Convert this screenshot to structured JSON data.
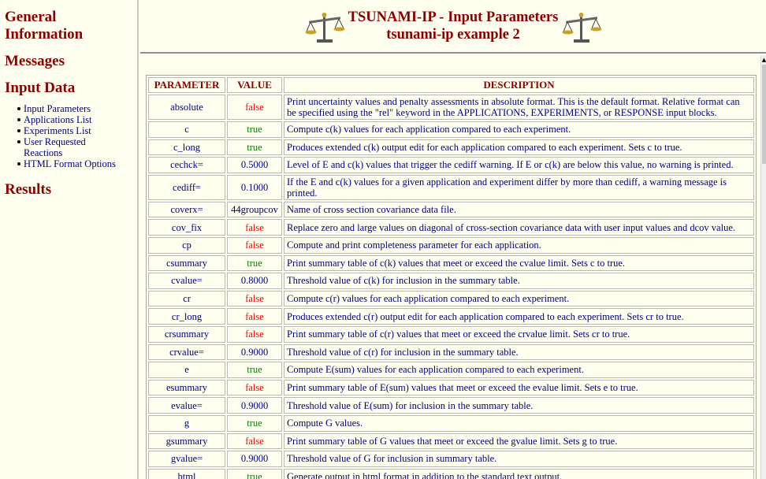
{
  "nav": {
    "general": "General\nInformation",
    "messages": "Messages",
    "input_data": "Input Data",
    "sub_items": [
      "Input Parameters",
      "Applications List",
      "Experiments List",
      "User Requested\nReactions",
      "HTML Format Options"
    ],
    "results": "Results"
  },
  "header": {
    "title": "TSUNAMI-IP - Input Parameters",
    "subtitle": "tsunami-ip example 2"
  },
  "table": {
    "headers": [
      "PARAMETER",
      "VALUE",
      "DESCRIPTION"
    ],
    "rows": [
      {
        "param": "absolute",
        "value": "false",
        "desc": "Print uncertainty values and penalty assessments in absolute format. This is the default format. Relative format can be specified using the \"rel\" keyword in the APPLICATIONS, EXPERIMENTS, or RESPONSE input blocks."
      },
      {
        "param": "c",
        "value": "true",
        "desc": "Compute c(k) values for each application compared to each experiment."
      },
      {
        "param": "c_long",
        "value": "true",
        "desc": "Produces extended c(k) output edit for each application compared to each experiment. Sets c to true."
      },
      {
        "param": "cechck=",
        "value": "0.5000",
        "desc": "Level of E and c(k) values that trigger the cediff warning. If E or c(k) are below this value, no warning is printed."
      },
      {
        "param": "cediff=",
        "value": "0.1000",
        "desc": "If the E and c(k) values for a given application and experiment differ by more than cediff, a warning message is printed."
      },
      {
        "param": "coverx=",
        "value": "44groupcov",
        "desc": "Name of cross section covariance data file."
      },
      {
        "param": "cov_fix",
        "value": "false",
        "desc": "Replace zero and large values on diagonal of cross-section covariance data with user input values and dcov value."
      },
      {
        "param": "cp",
        "value": "false",
        "desc": "Compute and print completeness parameter for each application."
      },
      {
        "param": "csummary",
        "value": "true",
        "desc": "Print summary table of c(k) values that meet or exceed the cvalue limit. Sets c to true."
      },
      {
        "param": "cvalue=",
        "value": "0.8000",
        "desc": "Threshold value of c(k) for inclusion in the summary table."
      },
      {
        "param": "cr",
        "value": "false",
        "desc": "Compute c(r) values for each application compared to each experiment."
      },
      {
        "param": "cr_long",
        "value": "false",
        "desc": "Produces extended c(r) output edit for each application compared to each experiment. Sets cr to true."
      },
      {
        "param": "crsummary",
        "value": "false",
        "desc": "Print summary table of c(r) values that meet or exceed the crvalue limit. Sets cr to true."
      },
      {
        "param": "crvalue=",
        "value": "0.9000",
        "desc": "Threshold value of c(r) for inclusion in the summary table."
      },
      {
        "param": "e",
        "value": "true",
        "desc": "Compute E(sum) values for each application compared to each experiment."
      },
      {
        "param": "esummary",
        "value": "false",
        "desc": "Print summary table of E(sum) values that meet or exceed the evalue limit. Sets e to true."
      },
      {
        "param": "evalue=",
        "value": "0.9000",
        "desc": "Threshold value of E(sum) for inclusion in the summary table."
      },
      {
        "param": "g",
        "value": "true",
        "desc": "Compute G values."
      },
      {
        "param": "gsummary",
        "value": "false",
        "desc": "Print summary table of G values that meet or exceed the gvalue limit. Sets g to true."
      },
      {
        "param": "gvalue=",
        "value": "0.9000",
        "desc": "Threshold value of G for inclusion in summary table."
      },
      {
        "param": "html",
        "value": "true",
        "desc": "Generate output in html format in addition to the standard text output."
      }
    ]
  },
  "colors": {
    "heading": "#8b0000",
    "text": "#000080",
    "true": "#008000",
    "false": "#ff0000",
    "background": "#fffff0"
  },
  "icons": [
    "balance-scale-icon"
  ]
}
